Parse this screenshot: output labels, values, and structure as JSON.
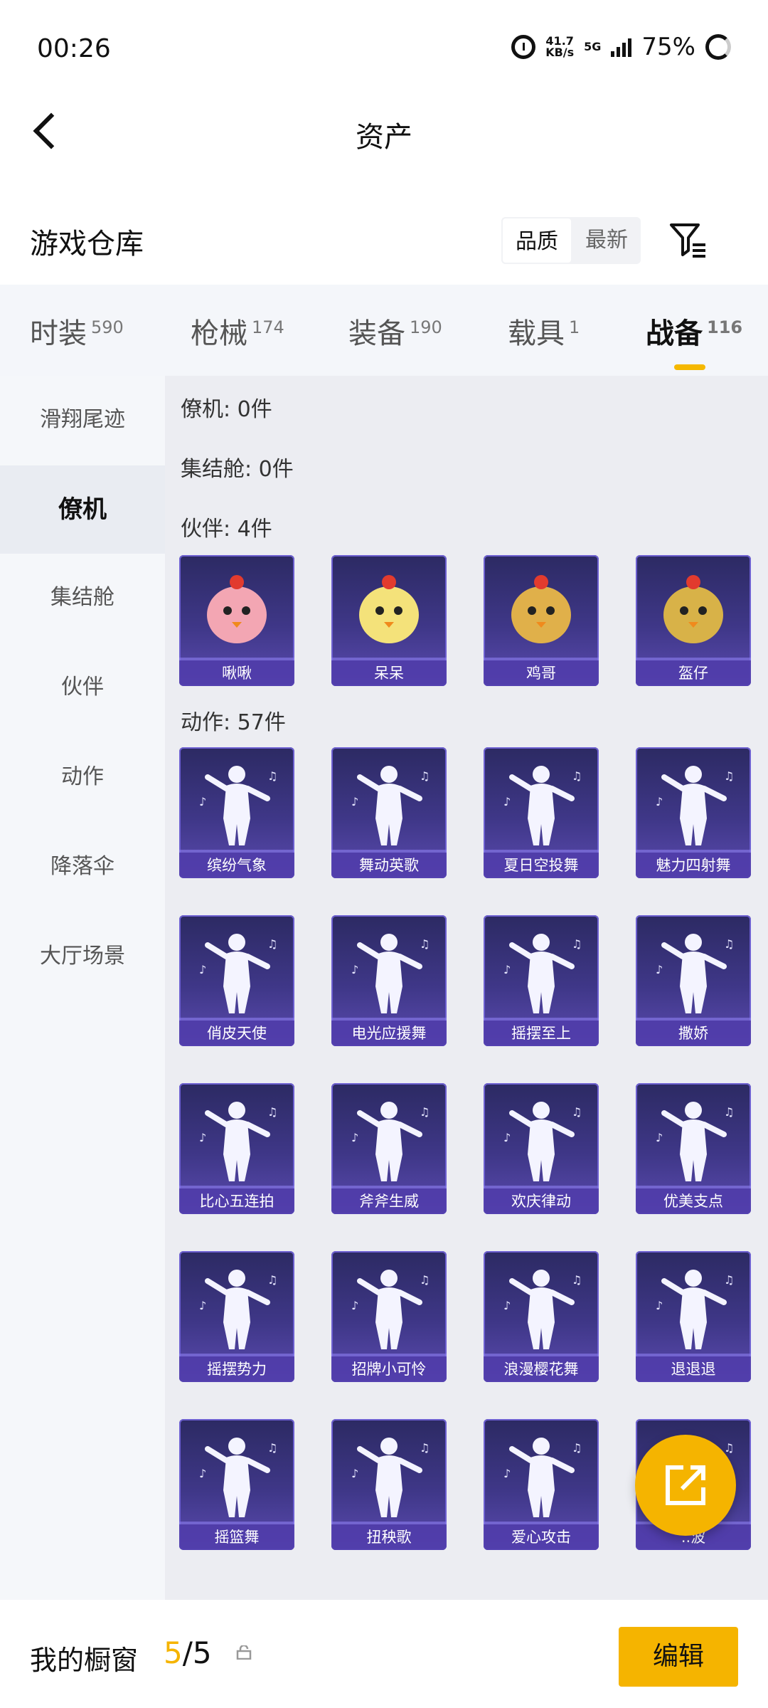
{
  "status_bar": {
    "time": "00:26",
    "net_speed": "41.7",
    "net_unit": "KB/s",
    "network": "5G",
    "battery": "75%"
  },
  "header": {
    "title": "资产"
  },
  "warehouse": {
    "title": "游戏仓库",
    "sort": [
      "品质",
      "最新"
    ]
  },
  "tabs": [
    {
      "label": "时装",
      "count": "590"
    },
    {
      "label": "枪械",
      "count": "174"
    },
    {
      "label": "装备",
      "count": "190"
    },
    {
      "label": "载具",
      "count": "1"
    },
    {
      "label": "战备",
      "count": "116"
    }
  ],
  "sidebar": [
    "滑翔尾迹",
    "僚机",
    "集结舱",
    "伙伴",
    "动作",
    "降落伞",
    "大厅场景"
  ],
  "groups": {
    "wingman": "僚机: 0件",
    "pod": "集结舱: 0件",
    "partner": "伙伴: 4件",
    "action": "动作: 57件"
  },
  "partners": [
    "啾啾",
    "呆呆",
    "鸡哥",
    "盔仔"
  ],
  "actions": [
    "缤纷气象",
    "舞动英歌",
    "夏日空投舞",
    "魅力四射舞",
    "俏皮天使",
    "电光应援舞",
    "摇摆至上",
    "撒娇",
    "比心五连拍",
    "斧斧生威",
    "欢庆律动",
    "优美支点",
    "摇摆势力",
    "招牌小可怜",
    "浪漫樱花舞",
    "退退退",
    "摇篮舞",
    "扭秧歌",
    "爱心攻击",
    "..波"
  ],
  "bottom": {
    "label": "我的橱窗",
    "count_current": "5",
    "count_total": "/5",
    "edit": "编辑"
  },
  "colors": {
    "accent": "#f5b400",
    "card_top": "#2c2a63",
    "card_bottom": "#5b4bb0"
  }
}
